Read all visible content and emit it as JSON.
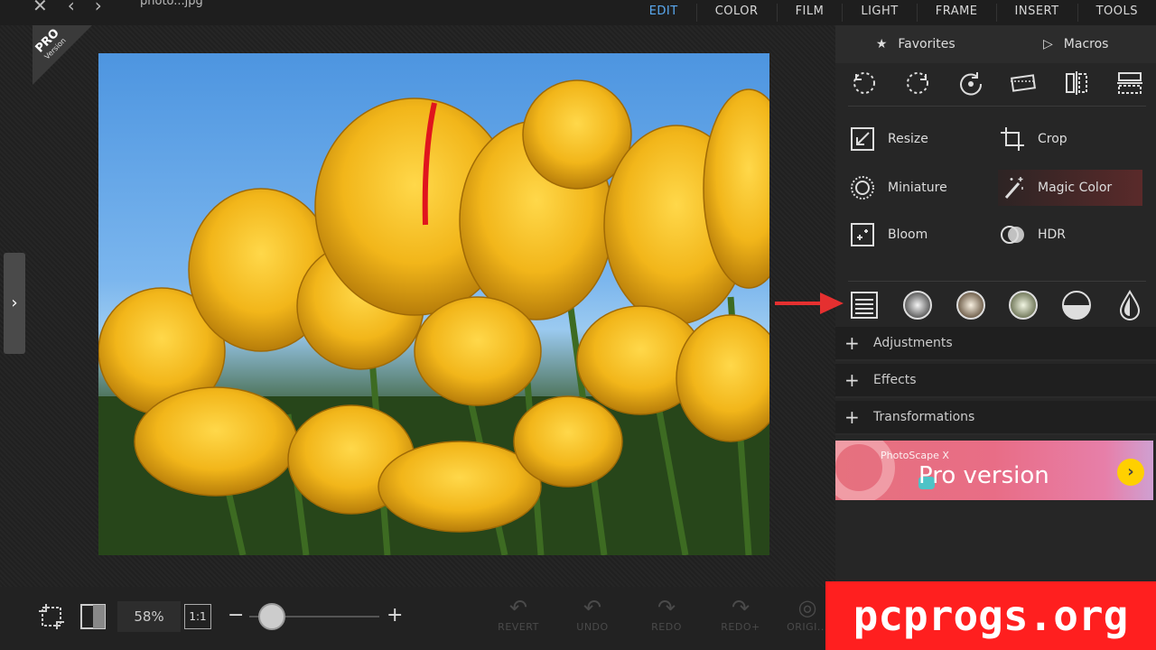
{
  "topbar": {
    "filename": "photo...jpg",
    "tabs": [
      {
        "label": "EDIT",
        "active": true
      },
      {
        "label": "COLOR"
      },
      {
        "label": "FILM"
      },
      {
        "label": "LIGHT"
      },
      {
        "label": "FRAME"
      },
      {
        "label": "INSERT"
      },
      {
        "label": "TOOLS"
      }
    ]
  },
  "canvas": {
    "pro_badge": {
      "line1": "PRO",
      "line2": "Version"
    }
  },
  "panel": {
    "favorites_label": "Favorites",
    "macros_label": "Macros",
    "rotate_icons": [
      "rotate-left-icon",
      "rotate-right-icon",
      "rotate-free-icon",
      "straighten-icon",
      "flip-horizontal-icon",
      "flip-vertical-icon"
    ],
    "tools": {
      "resize": "Resize",
      "crop": "Crop",
      "miniature": "Miniature",
      "magic_color": "Magic Color",
      "bloom": "Bloom",
      "hdr": "HDR"
    },
    "filter_icons": [
      "levels-icon",
      "vignette-icon",
      "tone-icon",
      "film-icon",
      "half-circle-icon",
      "drop-icon"
    ],
    "sections": [
      "Adjustments",
      "Effects",
      "Transformations"
    ],
    "banner": {
      "sub": "PhotoScape X",
      "main": "Pro version"
    }
  },
  "bottombar": {
    "zoom": "58%",
    "one_one": "1:1",
    "minus": "−",
    "plus": "+",
    "history": [
      {
        "label": "REVERT"
      },
      {
        "label": "UNDO"
      },
      {
        "label": "REDO"
      },
      {
        "label": "REDO+"
      },
      {
        "label": "ORIGI..."
      }
    ]
  },
  "watermark": "pcprogs.org",
  "colors": {
    "accent": "#5aa9f0",
    "arrow": "#e53030",
    "watermark_bg": "#ff1f1f"
  }
}
